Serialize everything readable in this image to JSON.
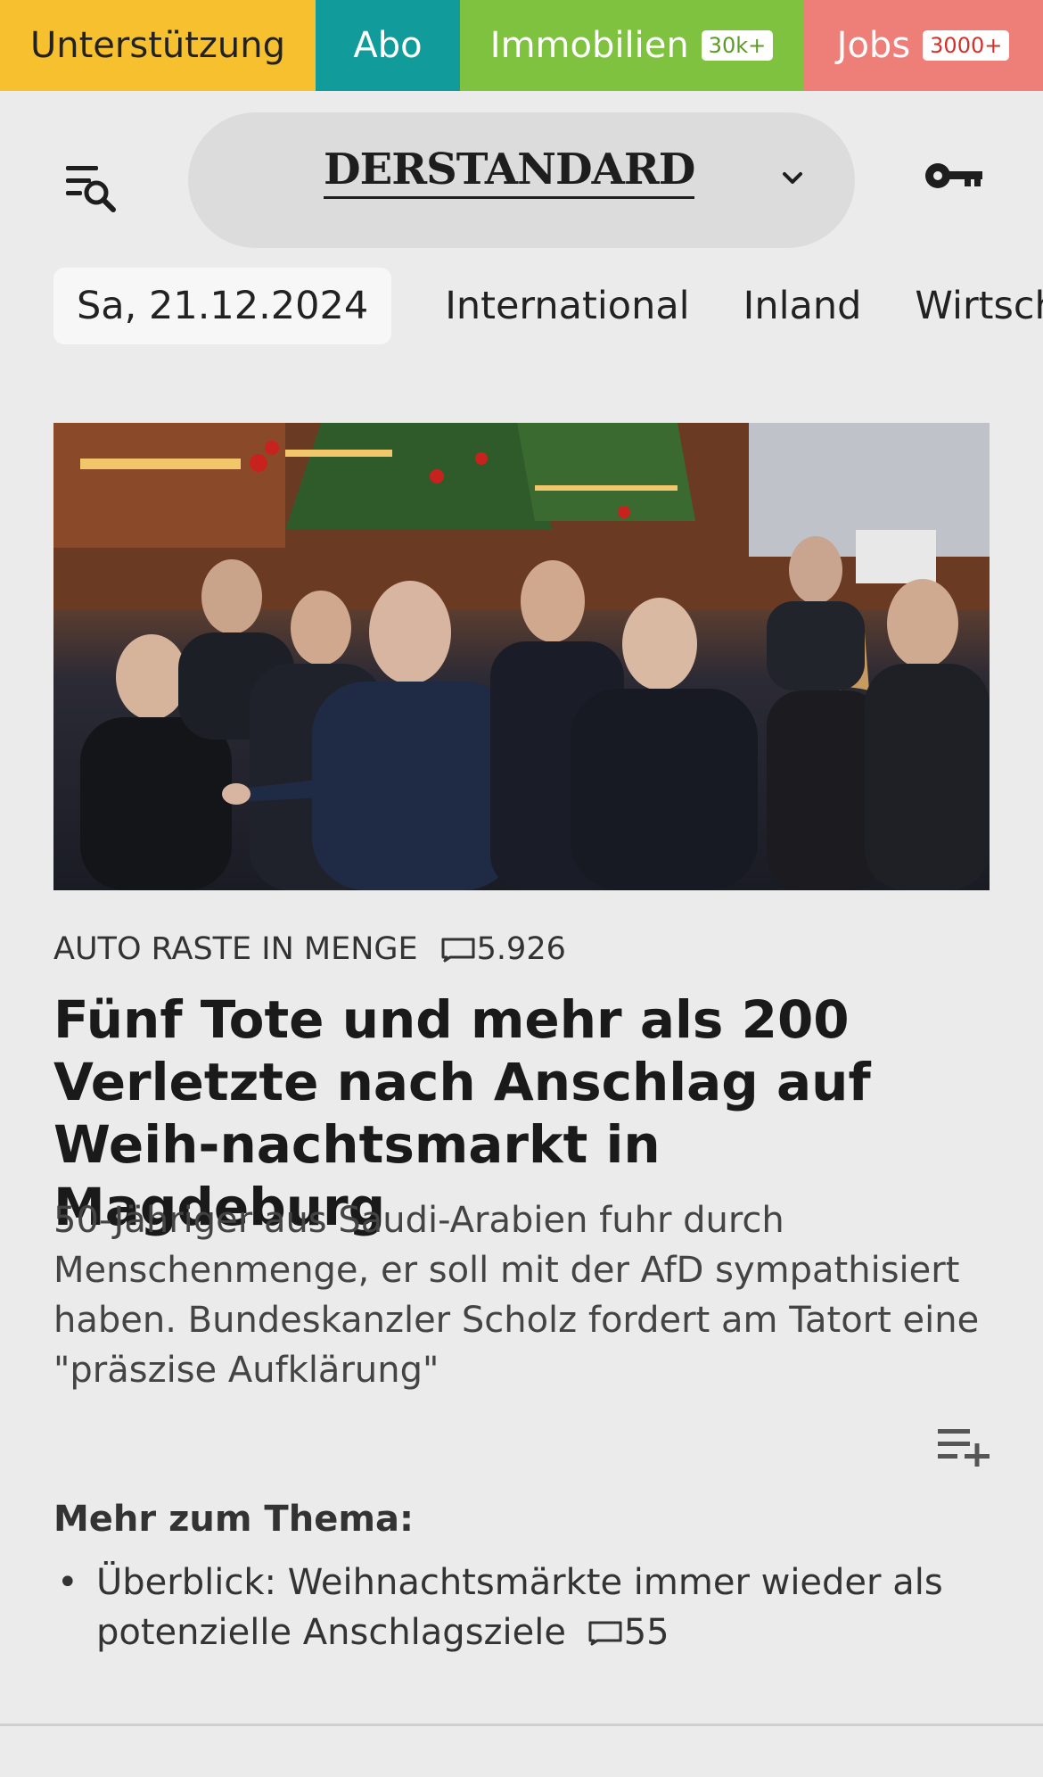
{
  "topbar": {
    "unterstuetzung": "Unterstützung",
    "abo": "Abo",
    "immobilien": "Immobilien",
    "immobilien_badge": "30k+",
    "jobs": "Jobs",
    "jobs_badge": "3000+"
  },
  "header": {
    "logo_der": "DER",
    "logo_standard": "STANDARD"
  },
  "nav": {
    "date": "Sa, 21.12.2024",
    "items": [
      "International",
      "Inland",
      "Wirtscha"
    ]
  },
  "article": {
    "kicker": "AUTO RASTE IN MENGE",
    "comment_count": "5.926",
    "headline": "Fünf Tote und mehr als 200 Verletzte nach Anschlag auf Weih-nachtsmarkt in Magdeburg",
    "teaser": "50-Jähriger aus Saudi-Arabien fuhr durch Menschenmenge, er soll mit der AfD sympathisiert haben. Bundeskanzler Scholz fordert am Tatort eine \"präszise Aufklärung\""
  },
  "more": {
    "title": "Mehr zum Thema:",
    "items": [
      {
        "text": "Überblick: Weihnachtsmärkte immer wieder als potenzielle Anschlagsziele",
        "comments": "55"
      }
    ]
  },
  "colors": {
    "unterstuetzung": "#f7c02f",
    "abo": "#119b9b",
    "immobilien": "#7fc240",
    "jobs": "#ee7f78",
    "background": "#ebebeb"
  }
}
